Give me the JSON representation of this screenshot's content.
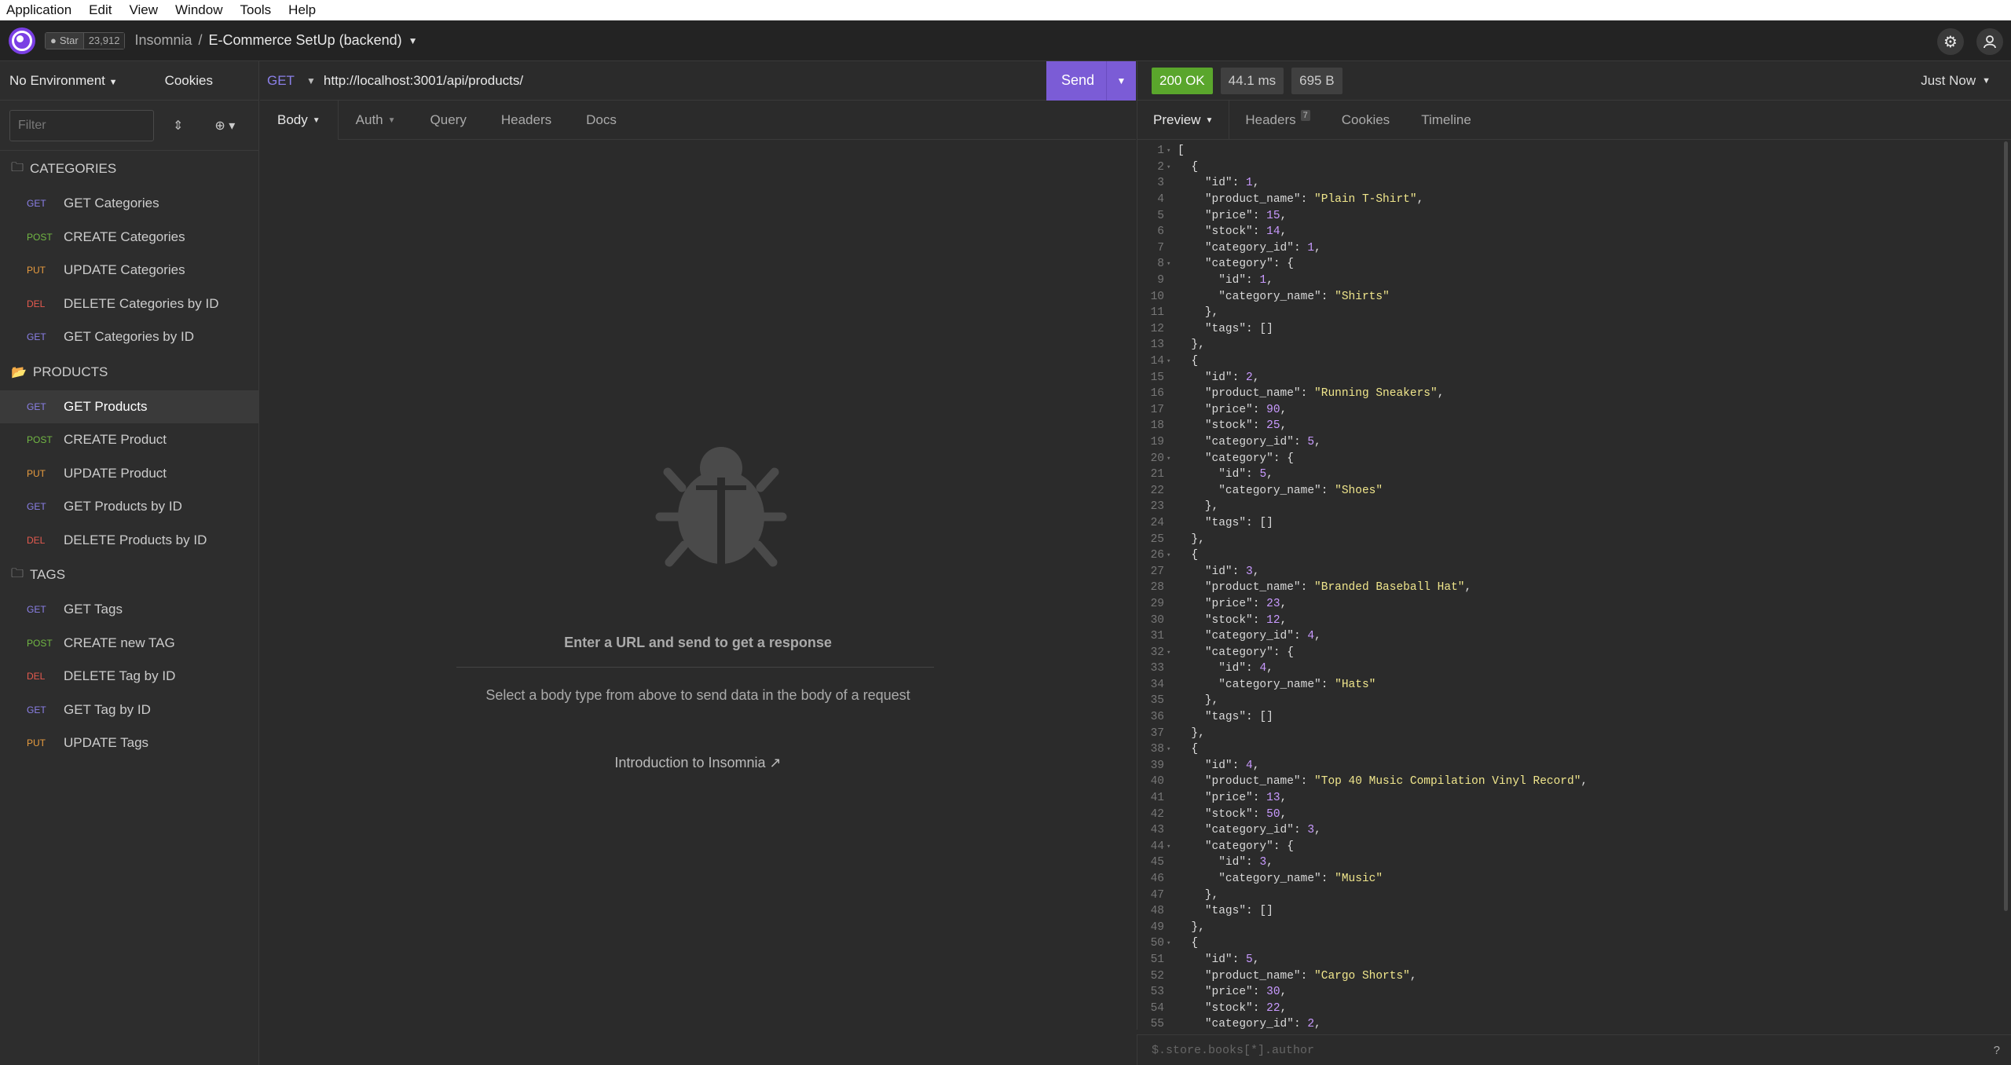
{
  "menu": [
    "Application",
    "Edit",
    "View",
    "Window",
    "Tools",
    "Help"
  ],
  "titlebar": {
    "star_label": "Star",
    "star_count": "23,912",
    "app_name": "Insomnia",
    "separator": "/",
    "project": "E-Commerce SetUp (backend)"
  },
  "sidebar": {
    "environment": "No Environment",
    "cookies": "Cookies",
    "filter_placeholder": "Filter",
    "groups": [
      {
        "name": "CATEGORIES",
        "items": [
          {
            "method": "GET",
            "label": "GET Categories"
          },
          {
            "method": "POST",
            "label": "CREATE Categories"
          },
          {
            "method": "PUT",
            "label": "UPDATE Categories"
          },
          {
            "method": "DEL",
            "label": "DELETE Categories by ID"
          },
          {
            "method": "GET",
            "label": "GET Categories by ID"
          }
        ]
      },
      {
        "name": "PRODUCTS",
        "items": [
          {
            "method": "GET",
            "label": "GET Products",
            "active": true
          },
          {
            "method": "POST",
            "label": "CREATE Product"
          },
          {
            "method": "PUT",
            "label": "UPDATE Product"
          },
          {
            "method": "GET",
            "label": "GET Products by ID"
          },
          {
            "method": "DEL",
            "label": "DELETE Products by ID"
          }
        ]
      },
      {
        "name": "TAGS",
        "items": [
          {
            "method": "GET",
            "label": "GET Tags"
          },
          {
            "method": "POST",
            "label": "CREATE new TAG"
          },
          {
            "method": "DEL",
            "label": "DELETE Tag by ID"
          },
          {
            "method": "GET",
            "label": "GET Tag by ID"
          },
          {
            "method": "PUT",
            "label": "UPDATE Tags"
          }
        ]
      }
    ]
  },
  "request": {
    "method": "GET",
    "url": "http://localhost:3001/api/products/",
    "send_label": "Send",
    "tabs": [
      "Body",
      "Auth",
      "Query",
      "Headers",
      "Docs"
    ],
    "empty_title": "Enter a URL and send to get a response",
    "empty_subtitle": "Select a body type from above to send data in the body of a request",
    "intro_link": "Introduction to Insomnia"
  },
  "response": {
    "status": "200 OK",
    "time": "44.1 ms",
    "size": "695 B",
    "when": "Just Now",
    "tabs": [
      {
        "label": "Preview",
        "dropdown": true
      },
      {
        "label": "Headers",
        "count": "7"
      },
      {
        "label": "Cookies"
      },
      {
        "label": "Timeline"
      }
    ],
    "filter_placeholder": "$.store.books[*].author",
    "products": [
      {
        "id": 1,
        "product_name": "Plain T-Shirt",
        "price": 15,
        "stock": 14,
        "category_id": 1,
        "category": {
          "id": 1,
          "category_name": "Shirts"
        }
      },
      {
        "id": 2,
        "product_name": "Running Sneakers",
        "price": 90,
        "stock": 25,
        "category_id": 5,
        "category": {
          "id": 5,
          "category_name": "Shoes"
        }
      },
      {
        "id": 3,
        "product_name": "Branded Baseball Hat",
        "price": 23,
        "stock": 12,
        "category_id": 4,
        "category": {
          "id": 4,
          "category_name": "Hats"
        }
      },
      {
        "id": 4,
        "product_name": "Top 40 Music Compilation Vinyl Record",
        "price": 13,
        "stock": 50,
        "category_id": 3,
        "category": {
          "id": 3,
          "category_name": "Music"
        }
      },
      {
        "id": 5,
        "product_name": "Cargo Shorts",
        "price": 30,
        "stock": 22,
        "category_id": 2
      }
    ]
  },
  "colors": {
    "accent": "#7b5cd6",
    "ok": "#5aa62c",
    "get": "#8b80e8",
    "post": "#72b844",
    "put": "#e89c3f",
    "del": "#e55a4f"
  }
}
